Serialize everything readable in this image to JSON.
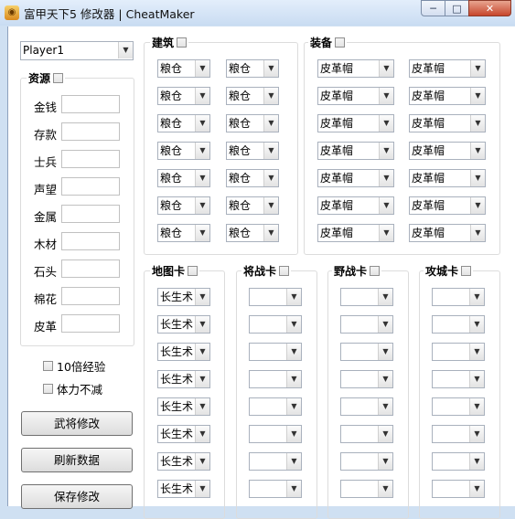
{
  "window": {
    "title": "富甲天下5 修改器 | CheatMaker",
    "min": "─",
    "max": "□",
    "close": "✕"
  },
  "player_select": {
    "value": "Player1"
  },
  "resources": {
    "label": "资源",
    "fields": [
      {
        "label": "金钱",
        "value": ""
      },
      {
        "label": "存款",
        "value": ""
      },
      {
        "label": "士兵",
        "value": ""
      },
      {
        "label": "声望",
        "value": ""
      },
      {
        "label": "金属",
        "value": ""
      },
      {
        "label": "木材",
        "value": ""
      },
      {
        "label": "石头",
        "value": ""
      },
      {
        "label": "棉花",
        "value": ""
      },
      {
        "label": "皮革",
        "value": ""
      }
    ]
  },
  "options": {
    "exp10": "10倍经验",
    "stamina": "体力不减"
  },
  "buttons": {
    "general": "武将修改",
    "refresh": "刷新数据",
    "save": "保存修改"
  },
  "building": {
    "label": "建筑",
    "value": "粮仓"
  },
  "equipment": {
    "label": "装备",
    "value": "皮革帽"
  },
  "card_groups": [
    {
      "label": "地图卡",
      "value": "长生术"
    },
    {
      "label": "将战卡",
      "value": ""
    },
    {
      "label": "野战卡",
      "value": ""
    },
    {
      "label": "攻城卡",
      "value": ""
    }
  ]
}
